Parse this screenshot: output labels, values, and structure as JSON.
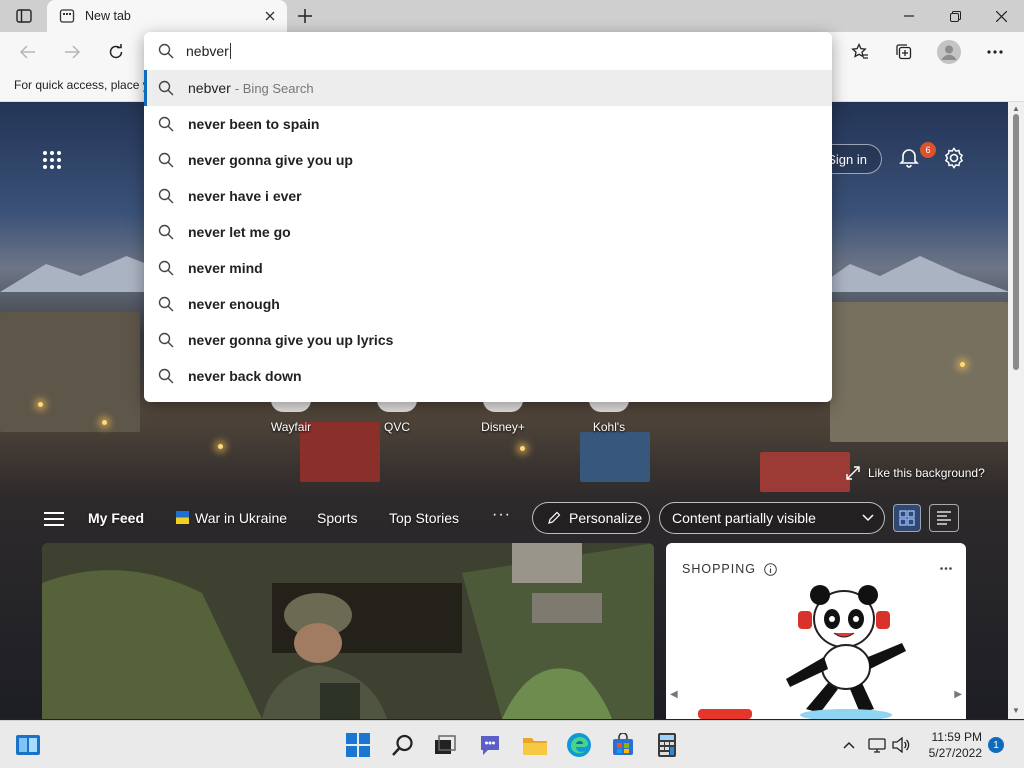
{
  "browser": {
    "tab_title": "New tab",
    "favorites_bar_message": "For quick access, place y"
  },
  "omnibox": {
    "query": "nebver",
    "suggestions": [
      {
        "text": "nebver",
        "source": "- Bing Search"
      },
      {
        "text": "never been to spain"
      },
      {
        "text": "never gonna give you up"
      },
      {
        "text": "never have i ever"
      },
      {
        "text": "never let me go"
      },
      {
        "text": "never mind"
      },
      {
        "text": "never enough"
      },
      {
        "text": "never gonna give you up lyrics"
      },
      {
        "text": "never back down"
      }
    ]
  },
  "newtab": {
    "sign_in_label": "Sign in",
    "notification_count": "6",
    "site_tiles": [
      "Wayfair",
      "QVC",
      "Disney+",
      "Kohl's"
    ],
    "like_background_label": "Like this background?",
    "feed_nav": {
      "my_feed": "My Feed",
      "war_in_ukraine": "War in Ukraine",
      "sports": "Sports",
      "top_stories": "Top Stories",
      "more": "···"
    },
    "personalize_label": "Personalize",
    "content_visibility": "Content partially visible",
    "shopping_header": "SHOPPING"
  },
  "taskbar": {
    "time": "11:59 PM",
    "date": "5/27/2022",
    "notification_count": "1"
  },
  "colors": {
    "accent": "#0f6cbd",
    "notification_badge": "#d9532c",
    "edge_icon": "#0f9ad6"
  }
}
